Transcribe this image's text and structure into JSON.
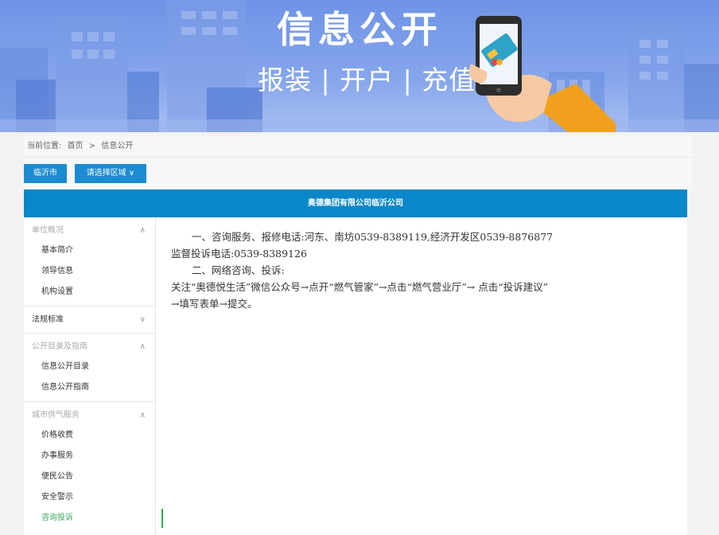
{
  "banner": {
    "title": "信息公开",
    "subtitle": "报装 | 开户 | 充值",
    "colors": {
      "sky": "#7a9be8",
      "building": "#5f84d8",
      "sleeve": "#f1a01e"
    }
  },
  "breadcrumb": {
    "prefix": "当前位置:",
    "home": "首页",
    "separator": ">",
    "current": "信息公开"
  },
  "toolbar": {
    "city_button": "临沂市",
    "region_button": "请选择区域 ∨"
  },
  "company": {
    "name": "奥德集团有限公司临沂公司"
  },
  "sidebar": {
    "sections": [
      {
        "label": "单位概况",
        "arrow": "∧",
        "items": [
          "基本简介",
          "领导信息",
          "机构设置"
        ]
      },
      {
        "label": "法规标准",
        "arrow": "∨",
        "items": []
      },
      {
        "label": "公开目录及指南",
        "arrow": "∧",
        "items": [
          "信息公开目录",
          "信息公开指南"
        ]
      },
      {
        "label": "城市供气服务",
        "arrow": "∧",
        "items": [
          "价格收费",
          "办事服务",
          "便民公告",
          "安全警示",
          "咨询投诉"
        ]
      }
    ]
  },
  "content": {
    "lines": [
      "一、咨询服务、报修电话:河东、南坊0539-8389119,经济开发区0539-8876877",
      "监督投诉电话:0539-8389126",
      "二、网络咨询、投诉:",
      "关注“奥德悦生活”微信公众号→点开“燃气管家”→点击“燃气营业厅”→ 点击“投诉建议”",
      "→填写表单→提交。"
    ]
  },
  "accent_colors": {
    "primary": "#1b8bd2",
    "active": "#3aa65a"
  }
}
